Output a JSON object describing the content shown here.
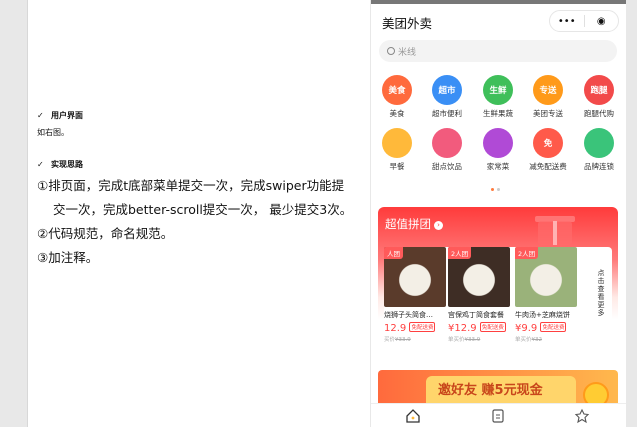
{
  "doc": {
    "section1_heading": "用户界面",
    "section1_note": "如右图。",
    "section2_heading": "实现思路",
    "lines": [
      "①排页面，完成t底部菜单提交一次，完成swiper功能提",
      "交一次，完成better-scroll提交一次， 最少提交3次。",
      "②代码规范，命名规范。",
      "③加注释。"
    ],
    "check_glyph": "✓"
  },
  "phone": {
    "title": "美团外卖",
    "capsule_menu": "•••",
    "capsule_close": "◉",
    "search_placeholder": "米线",
    "categories": [
      {
        "circle": "美食",
        "label": "美食",
        "color": "#ff6a3d"
      },
      {
        "circle": "超市",
        "label": "超市便利",
        "color": "#3a8ff5"
      },
      {
        "circle": "生鲜",
        "label": "生鲜果蔬",
        "color": "#3fbf5a"
      },
      {
        "circle": "专送",
        "label": "美团专送",
        "color": "#ff9a1a"
      },
      {
        "circle": "跑腿",
        "label": "跑腿代购",
        "color": "#f24a4a"
      },
      {
        "circle": "",
        "label": "早餐",
        "color": "#ffb93a"
      },
      {
        "circle": "",
        "label": "甜点饮品",
        "color": "#f25b7d"
      },
      {
        "circle": "",
        "label": "家常菜",
        "color": "#b04ad6"
      },
      {
        "circle": "免",
        "label": "减免配送费",
        "color": "#ff5a4a"
      },
      {
        "circle": "",
        "label": "品牌连锁",
        "color": "#3ac47a"
      }
    ],
    "group_title": "超值拼团",
    "group_arrow": "›",
    "group_cards": [
      {
        "tag": "人团",
        "name": "烧狮子头简食…",
        "price": "12.9",
        "free": "免配送费",
        "orig": "买价",
        "orig_price": "¥33.9",
        "img_color": "#5a3b2b"
      },
      {
        "tag": "2人团",
        "name": "宫保鸡丁简食套餐",
        "price": "¥12.9",
        "free": "免配送费",
        "orig": "单买价",
        "orig_price": "¥33.9",
        "img_color": "#3e2d25"
      },
      {
        "tag": "2人团",
        "name": "牛肉汤+芝麻烧饼",
        "price": "¥9.9",
        "free": "免配送费",
        "orig": "单买价",
        "orig_price": "¥32",
        "img_color": "#9ab27a"
      }
    ],
    "more_text": "点击查看更多",
    "banner_text": "邀好友 赚5元现金",
    "colors": {
      "accent": "#ff4040",
      "bar": "#777777"
    }
  }
}
